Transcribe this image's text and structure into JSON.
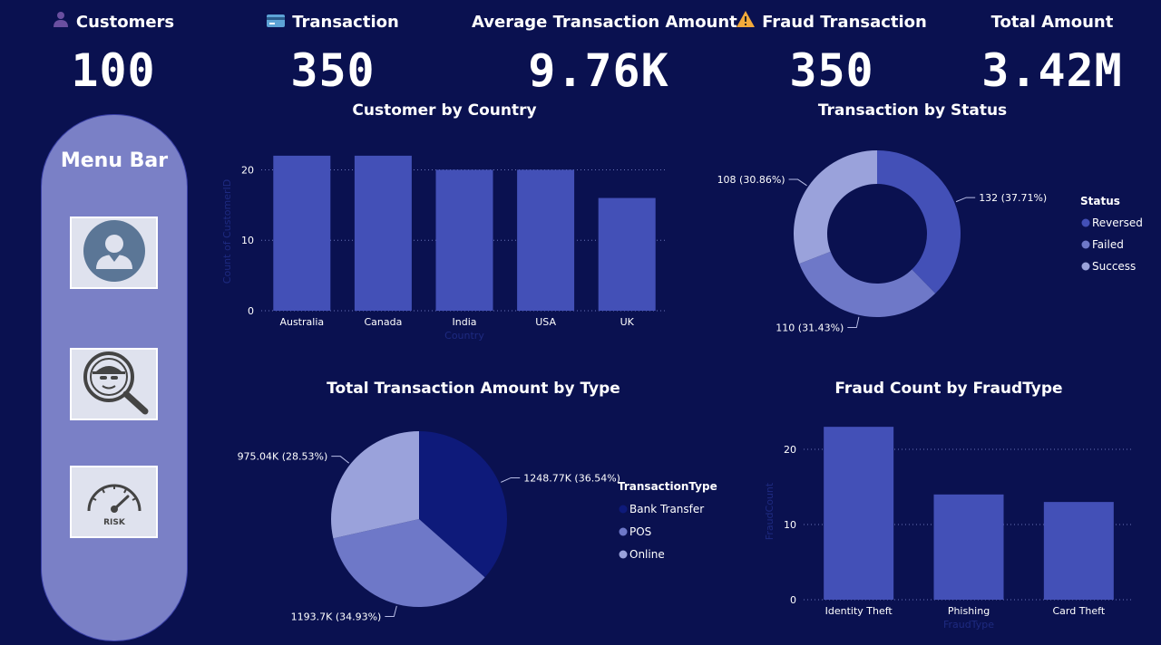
{
  "kpis": [
    {
      "title": "Customers",
      "value": "100",
      "icon": "person-icon"
    },
    {
      "title": "Transaction",
      "value": "350",
      "icon": "credit-card-icon"
    },
    {
      "title": "Average Transaction Amount",
      "value": "9.76K",
      "icon": ""
    },
    {
      "title": "Fraud Transaction",
      "value": "350",
      "icon": "warning-icon"
    },
    {
      "title": "Total Amount",
      "value": "3.42M",
      "icon": ""
    }
  ],
  "menu": {
    "title": "Menu Bar",
    "items": [
      {
        "icon": "customer-avatar-icon"
      },
      {
        "icon": "fraud-investigation-icon"
      },
      {
        "icon": "risk-gauge-icon",
        "label": "RISK"
      }
    ]
  },
  "colors": {
    "background": "#0a1150",
    "bar": "#4350b7",
    "dark": "#0e1a7a",
    "mid": "#6e78c8",
    "light": "#9aa2db"
  },
  "chart_data": [
    {
      "type": "bar",
      "title": "Customer by Country",
      "xlabel": "Country",
      "ylabel": "Count of CustomerID",
      "categories": [
        "Australia",
        "Canada",
        "India",
        "USA",
        "UK"
      ],
      "values": [
        22,
        22,
        20,
        20,
        16
      ],
      "yticks": [
        "0",
        "10",
        "20"
      ],
      "ylim": [
        0,
        22.5
      ],
      "grid": true
    },
    {
      "type": "pie",
      "donut": true,
      "title": "Transaction by Status",
      "legend_title": "Status",
      "legend_position": "right",
      "slices": [
        {
          "name": "Reversed",
          "value": 132,
          "label": "132 (37.71%)",
          "color": "#4350b7"
        },
        {
          "name": "Failed",
          "value": 110,
          "label": "110 (31.43%)",
          "color": "#6e78c8"
        },
        {
          "name": "Success",
          "value": 108,
          "label": "108 (30.86%)",
          "color": "#9aa2db"
        }
      ]
    },
    {
      "type": "pie",
      "title": "Total Transaction Amount by Type",
      "legend_title": "TransactionType",
      "legend_position": "right",
      "slices": [
        {
          "name": "Bank Transfer",
          "value": 1248.77,
          "label": "1248.77K (36.54%)",
          "color": "#0e1a7a"
        },
        {
          "name": "POS",
          "value": 1193.7,
          "label": "1193.7K (34.93%)",
          "color": "#6e78c8"
        },
        {
          "name": "Online",
          "value": 975.04,
          "label": "975.04K (28.53%)",
          "color": "#9aa2db"
        }
      ]
    },
    {
      "type": "bar",
      "title": "Fraud Count by FraudType",
      "xlabel": "FraudType",
      "ylabel": "FraudCount",
      "categories": [
        "Identity Theft",
        "Phishing",
        "Card Theft"
      ],
      "values": [
        23,
        14,
        13
      ],
      "yticks": [
        "0",
        "10",
        "20"
      ],
      "ylim": [
        0,
        23.5
      ],
      "grid": true
    }
  ]
}
